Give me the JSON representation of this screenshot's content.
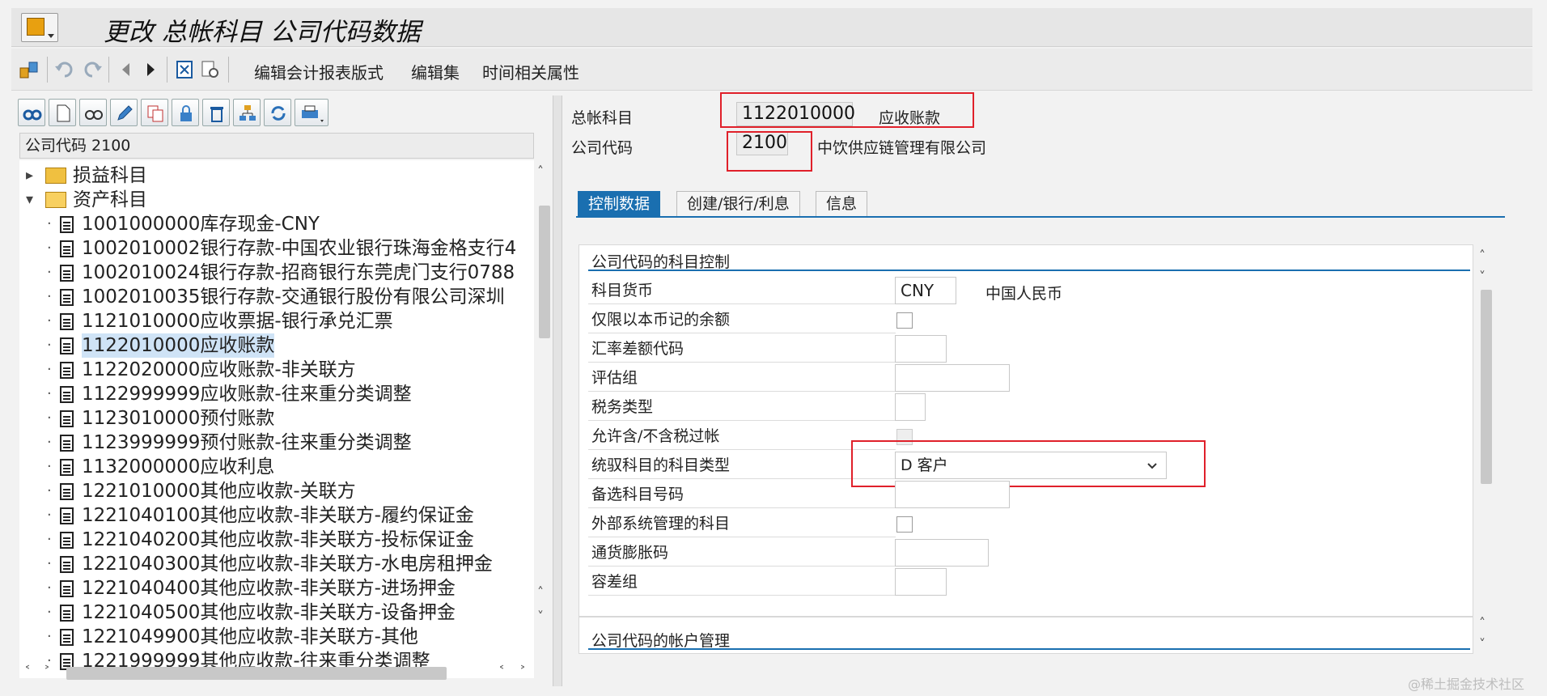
{
  "window": {
    "title": "更改 总帐科目 公司代码数据"
  },
  "toolbar": {
    "menu_1": "编辑会计报表版式",
    "menu_2": "编辑集",
    "menu_3": "时间相关属性",
    "icons": [
      "switch-icon",
      "undo-icon",
      "redo-icon",
      "prev-icon",
      "next-icon",
      "delete-icon",
      "print-preview-icon"
    ]
  },
  "left_panel": {
    "header": "公司代码 2100",
    "tools": [
      "find-icon",
      "create-icon",
      "display-icon",
      "edit-icon",
      "copy-icon",
      "lock-icon",
      "delete-icon",
      "hierarchy-icon",
      "refresh-icon",
      "print-icon"
    ],
    "folders": [
      {
        "label": "损益科目",
        "expanded": false
      },
      {
        "label": "资产科目",
        "expanded": true
      }
    ],
    "accounts": [
      "1001000000库存现金-CNY",
      "1002010002银行存款-中国农业银行珠海金格支行4",
      "1002010024银行存款-招商银行东莞虎门支行0788",
      "1002010035银行存款-交通银行股份有限公司深圳",
      "1121010000应收票据-银行承兑汇票",
      "1122010000应收账款",
      "1122020000应收账款-非关联方",
      "1122999999应收账款-往来重分类调整",
      "1123010000预付账款",
      "1123999999预付账款-往来重分类调整",
      "1132000000应收利息",
      "1221010000其他应收款-关联方",
      "1221040100其他应收款-非关联方-履约保证金",
      "1221040200其他应收款-非关联方-投标保证金",
      "1221040300其他应收款-非关联方-水电房租押金",
      "1221040400其他应收款-非关联方-进场押金",
      "1221040500其他应收款-非关联方-设备押金",
      "1221049900其他应收款-非关联方-其他",
      "1221999999其他应收款-往来重分类调整"
    ],
    "selected_index": 5
  },
  "header_fields": {
    "gl_account_label": "总帐科目",
    "gl_account_value": "1122010000",
    "gl_account_desc": "应收账款",
    "company_code_label": "公司代码",
    "company_code_value": "2100",
    "company_code_desc": "中饮供应链管理有限公司"
  },
  "tabs": [
    "控制数据",
    "创建/银行/利息",
    "信息"
  ],
  "active_tab": 0,
  "section_control": {
    "title": "公司代码的科目控制",
    "account_currency_label": "科目货币",
    "account_currency_value": "CNY",
    "account_currency_desc": "中国人民币",
    "local_currency_only_label": "仅限以本币记的余额",
    "exchange_rate_diff_label": "汇率差额代码",
    "valuation_group_label": "评估组",
    "tax_category_label": "税务类型",
    "posting_without_tax_label": "允许含/不含税过帐",
    "recon_account_type_label": "统驭科目的科目类型",
    "recon_account_type_value": "D 客户",
    "alternative_account_label": "备选科目号码",
    "external_system_label": "外部系统管理的科目",
    "inflation_key_label": "通货膨胀码",
    "tolerance_group_label": "容差组"
  },
  "section_management": {
    "title": "公司代码的帐户管理"
  },
  "watermark": "@稀土掘金技术社区",
  "colors": {
    "accent": "#1a6fb0",
    "highlight_box": "#e0202a",
    "selection": "#cfe3f6"
  }
}
